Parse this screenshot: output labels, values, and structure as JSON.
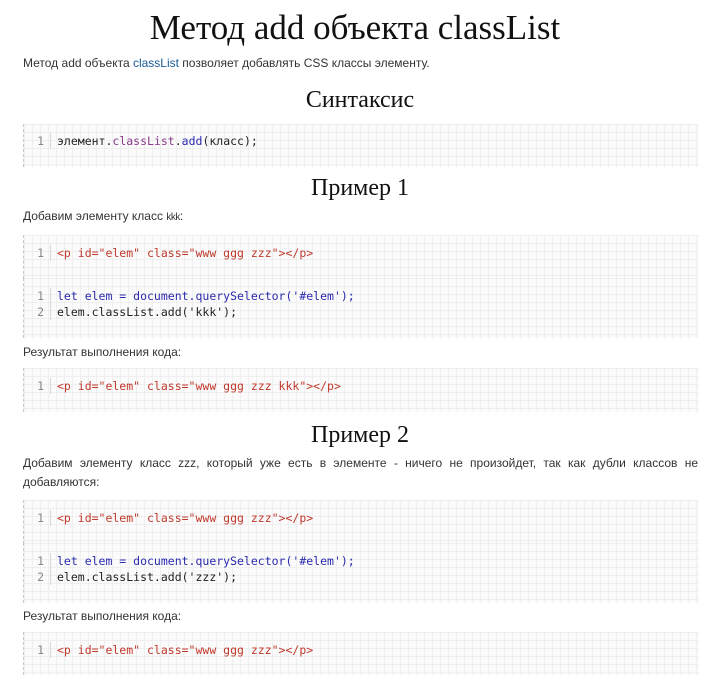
{
  "title": "Метод add объекта classList",
  "intro": {
    "text_before": "Метод add объекта ",
    "link": "classList",
    "text_after": " позволяет добавлять CSS классы элементу."
  },
  "syntax": {
    "heading": "Синтаксис",
    "code": [
      {
        "n": "1",
        "parts": [
          "элемент",
          ".",
          "classList",
          ".",
          "add",
          "(класс);"
        ]
      }
    ]
  },
  "example1": {
    "heading": "Пример 1",
    "desc_before": "Добавим элементу класс ",
    "desc_class": "kkk",
    "desc_after": ":",
    "html_code": {
      "n": "1",
      "text": "<p id=\"elem\" class=\"www ggg zzz\"></p>"
    },
    "js_code": [
      {
        "n": "1",
        "text": "let elem = document.querySelector('#elem');"
      },
      {
        "n": "2",
        "text": "elem.classList.add('kkk');"
      }
    ],
    "result_label": "Результат выполнения кода:",
    "result_code": {
      "n": "1",
      "text": "<p id=\"elem\" class=\"www ggg zzz kkk\"></p>"
    }
  },
  "example2": {
    "heading": "Пример 2",
    "desc": "Добавим элементу класс zzz, который уже есть в элементе - ничего не произойдет, так как дубли классов не добавляются:",
    "html_code": {
      "n": "1",
      "text": "<p id=\"elem\" class=\"www ggg zzz\"></p>"
    },
    "js_code": [
      {
        "n": "1",
        "text": "let elem = document.querySelector('#elem');"
      },
      {
        "n": "2",
        "text": "elem.classList.add('zzz');"
      }
    ],
    "result_label": "Результат выполнения кода:",
    "result_code": {
      "n": "1",
      "text": "<p id=\"elem\" class=\"www ggg zzz\"></p>"
    }
  }
}
